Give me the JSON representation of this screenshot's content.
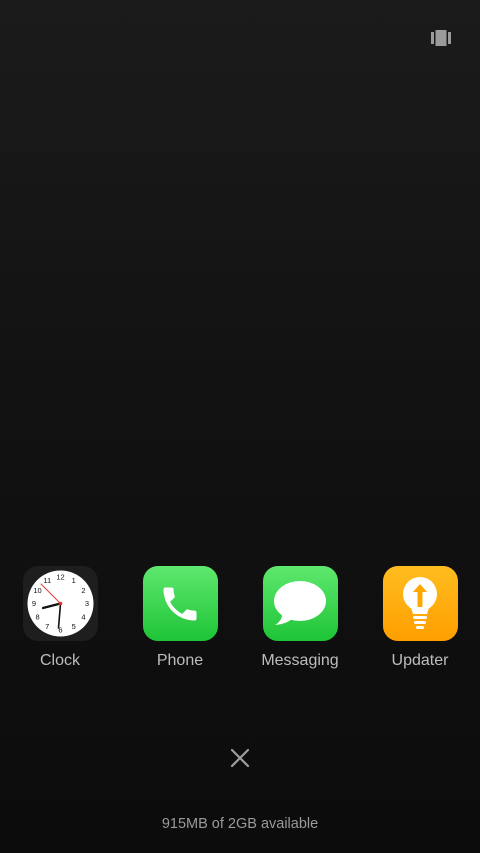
{
  "top_right": {
    "icon": "multi-window-icon"
  },
  "apps": [
    {
      "name": "clock",
      "label": "Clock",
      "icon": "clock-icon"
    },
    {
      "name": "phone",
      "label": "Phone",
      "icon": "phone-icon"
    },
    {
      "name": "messaging",
      "label": "Messaging",
      "icon": "message-bubble-icon"
    },
    {
      "name": "updater",
      "label": "Updater",
      "icon": "lightbulb-upload-icon"
    }
  ],
  "clock_face": {
    "numbers": [
      "12",
      "1",
      "2",
      "3",
      "4",
      "5",
      "6",
      "7",
      "8",
      "9",
      "10",
      "11"
    ]
  },
  "close": {
    "icon": "close-icon"
  },
  "memory": {
    "text": "915MB of 2GB available"
  },
  "colors": {
    "background": "#111111",
    "label": "#bdbdbd",
    "green": "#2bcf44",
    "orange": "#ffa800"
  }
}
